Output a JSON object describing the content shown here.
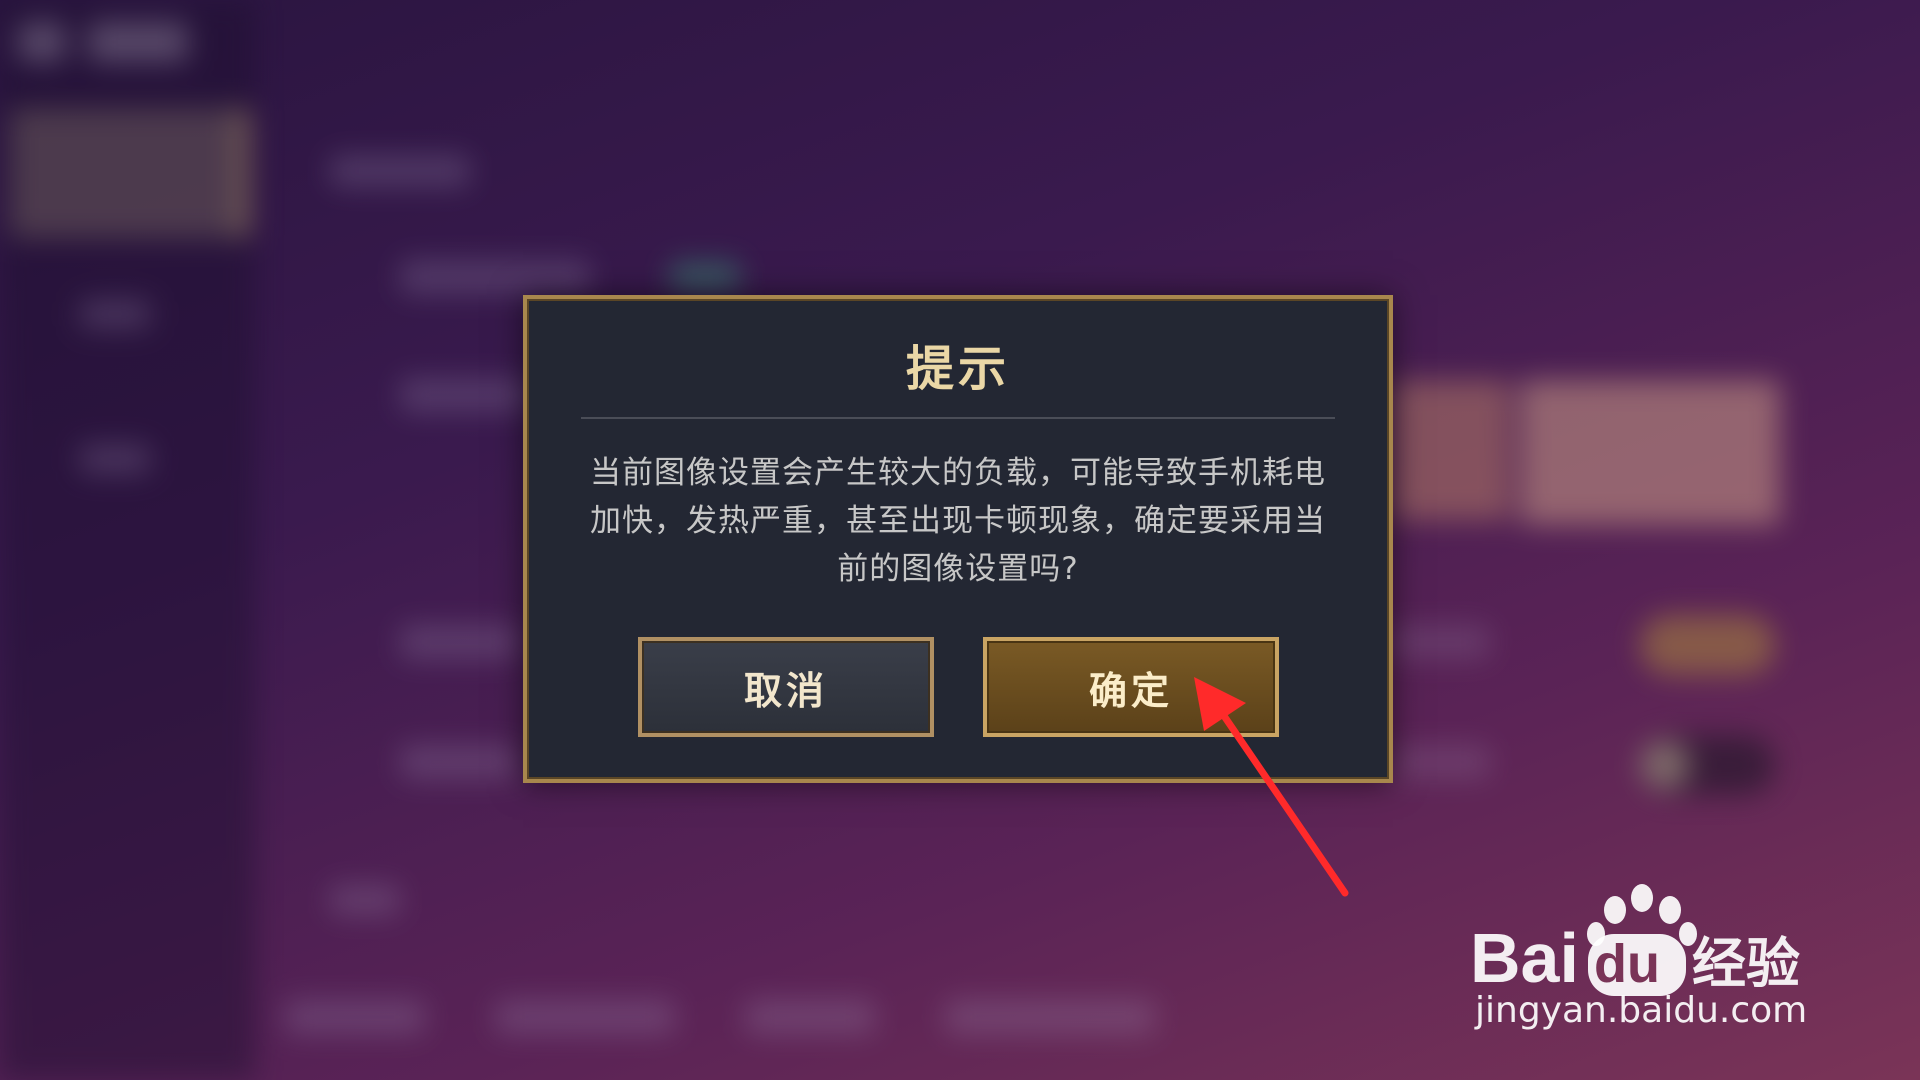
{
  "dialog": {
    "title": "提示",
    "message": "当前图像设置会产生较大的负载，可能导致手机耗电加快，发热严重，甚至出现卡顿现象，确定要采用当前的图像设置吗?",
    "cancel_label": "取消",
    "confirm_label": "确定"
  },
  "annotation": {
    "arrow_color": "#ff2a2a",
    "points_to": "confirm-button"
  },
  "watermark": {
    "brand": "Baidu经验",
    "url": "jingyan.baidu.com"
  },
  "colors": {
    "dialog_bg": "#232733",
    "dialog_border": "#a8874d",
    "title": "#ead7a6",
    "confirm_bg": "#6a4d1f"
  }
}
